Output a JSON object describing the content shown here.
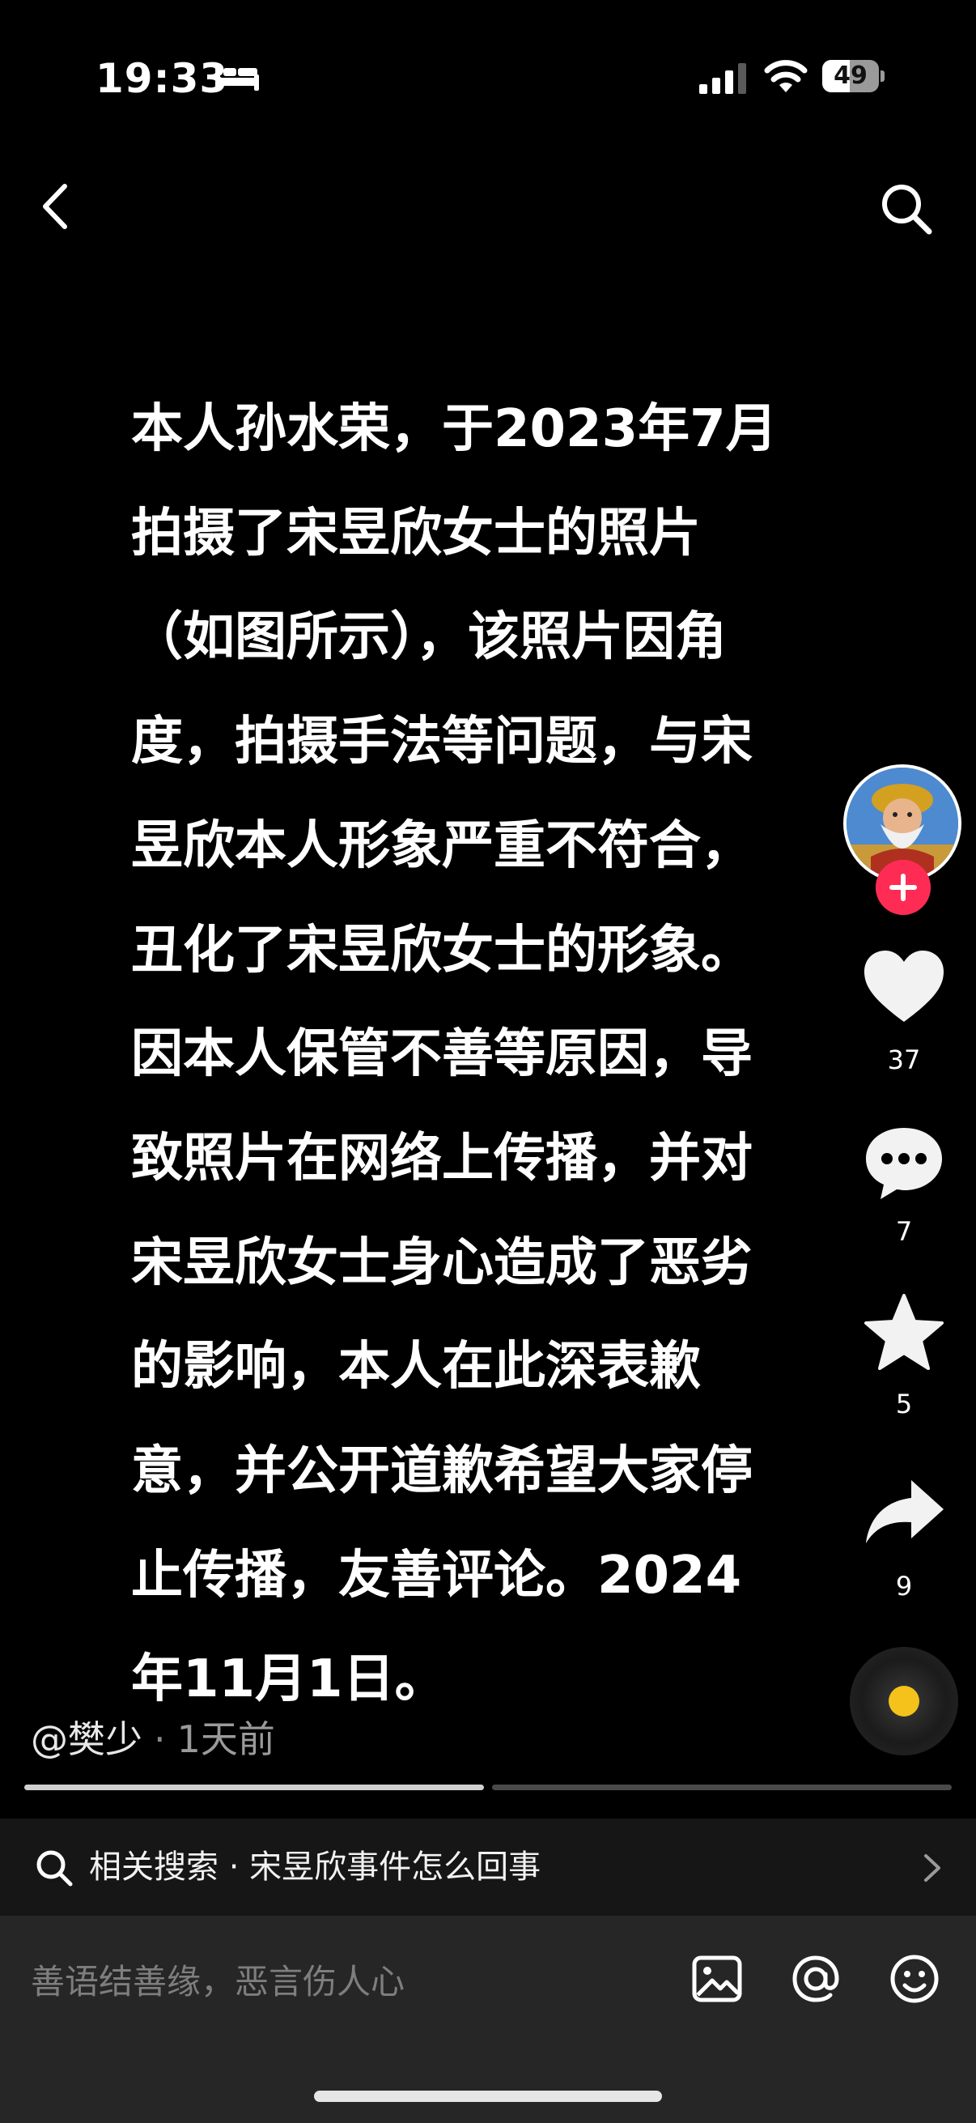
{
  "status": {
    "time": "19:33",
    "battery": "49",
    "battery_level": 0.49
  },
  "post": {
    "text": "本人孙水荣，于2023年7月\n拍摄了宋昱欣女士的照片\n（如图所示），该照片因角\n度，拍摄手法等问题，与宋\n昱欣本人形象严重不符合，\n丑化了宋昱欣女士的形象。\n因本人保管不善等原因，导\n致照片在网络上传播，并对\n宋昱欣女士身心造成了恶劣\n的影响，本人在此深表歉\n意，并公开道歉希望大家停\n止传播，友善评论。2024\n年11月1日。"
  },
  "actions": {
    "likes": "37",
    "comments": "7",
    "favorites": "5",
    "shares": "9"
  },
  "author": {
    "name": "@樊少",
    "time": "1天前"
  },
  "progress": {
    "segments": 2,
    "current": 1
  },
  "related": {
    "label": "相关搜索 · 宋昱欣事件怎么回事"
  },
  "comment": {
    "placeholder": "善语结善缘，恶言伤人心"
  },
  "colors": {
    "background": "#000000",
    "follow": "#fe2c55",
    "music": "#f4c21a"
  }
}
